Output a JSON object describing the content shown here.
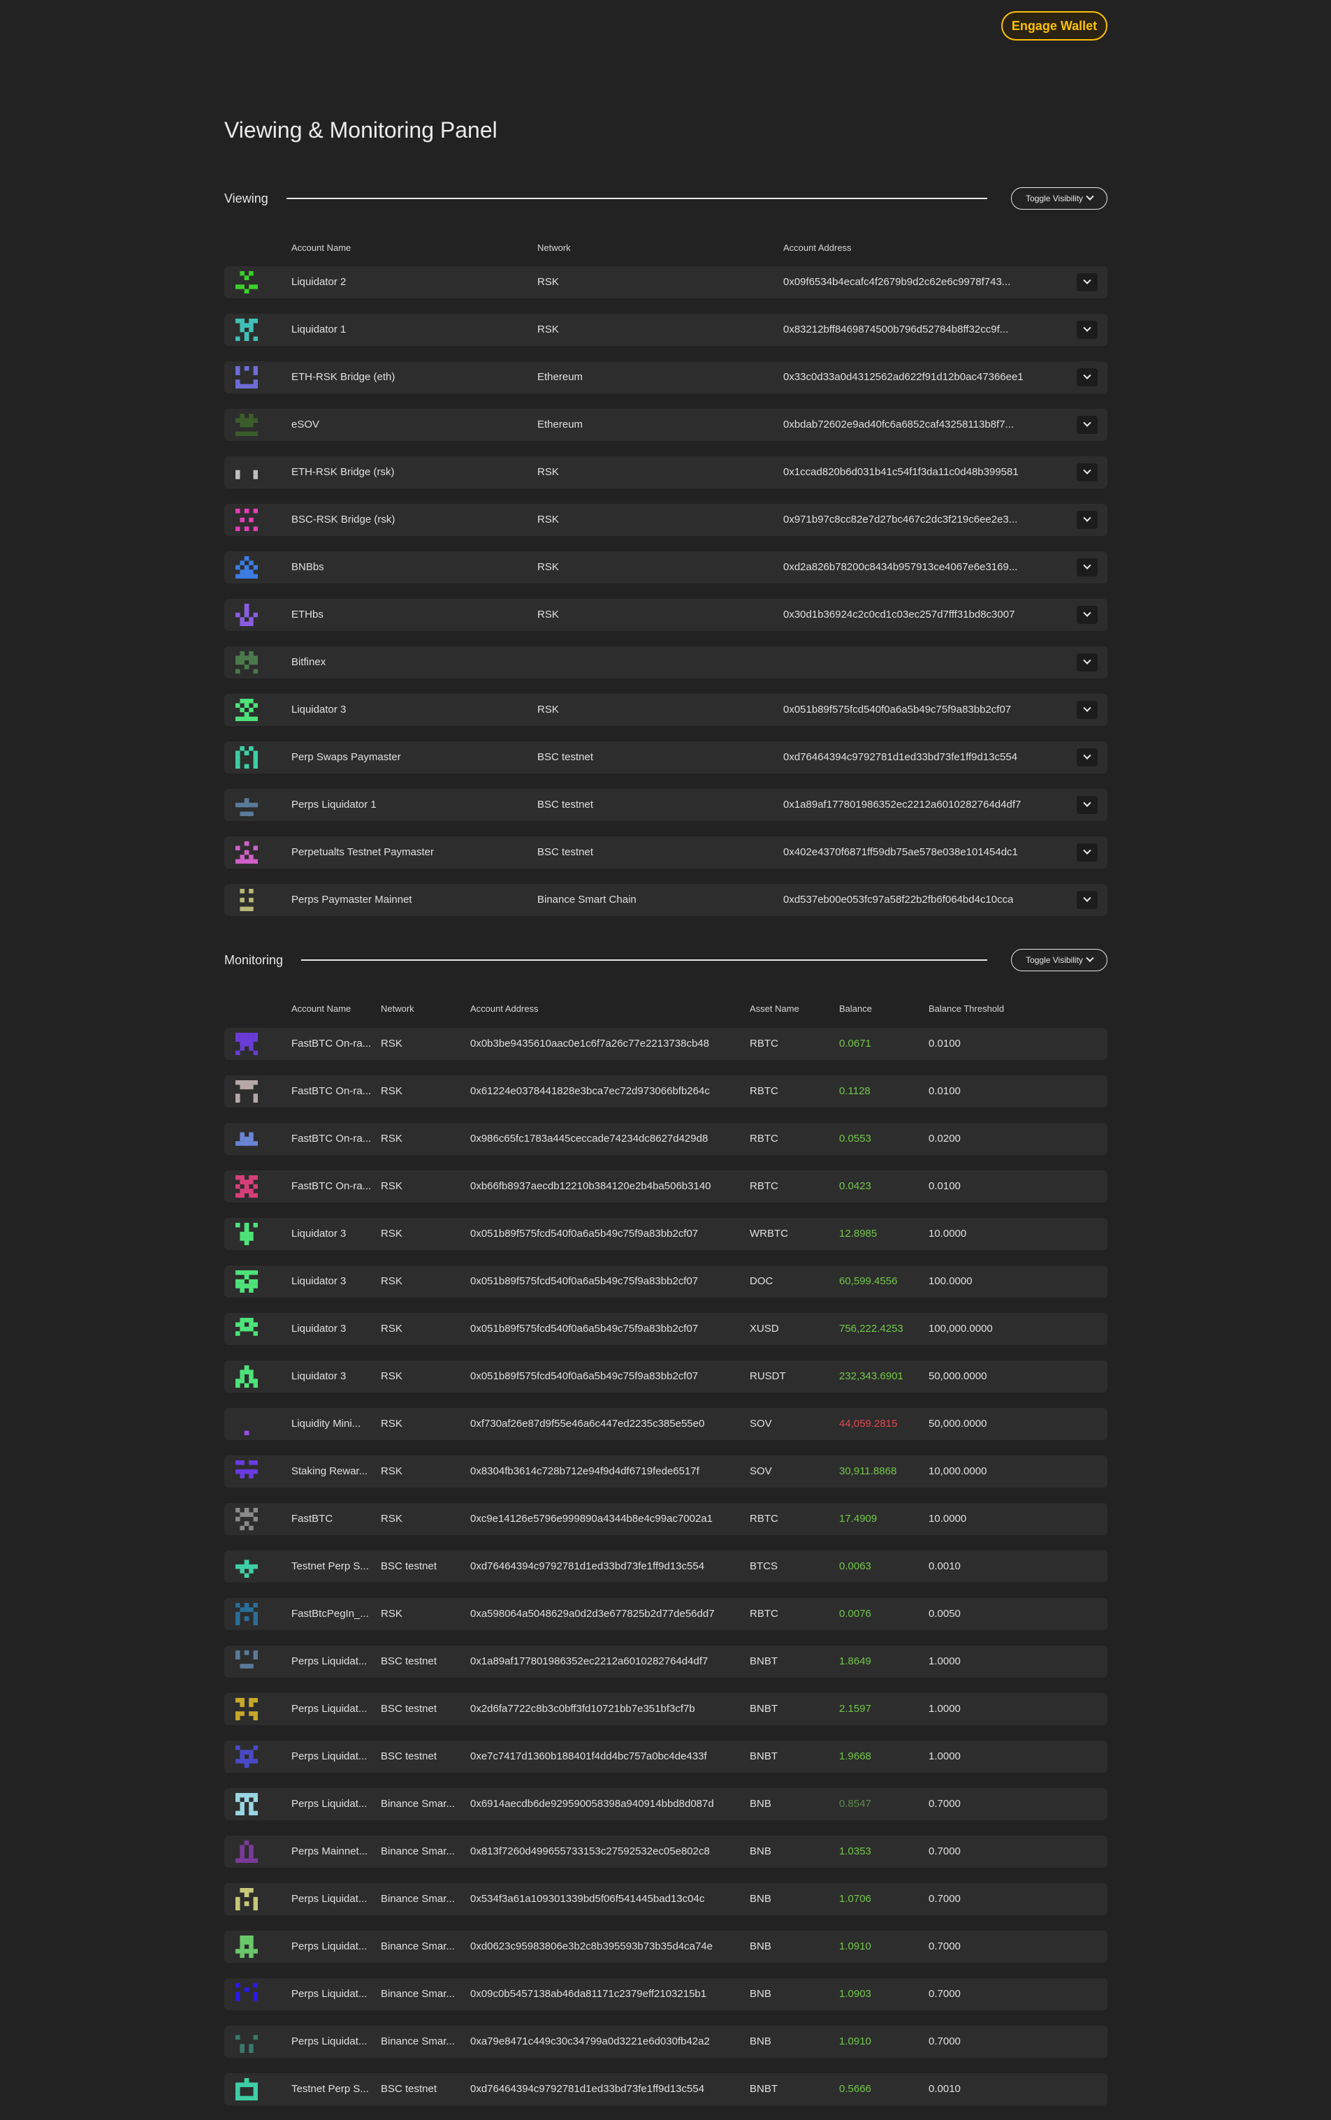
{
  "header": {
    "engage_wallet": "Engage Wallet"
  },
  "page_title": "Viewing & Monitoring Panel",
  "viewing": {
    "label": "Viewing",
    "toggle": "Toggle Visibility",
    "columns": [
      "Account Name",
      "Network",
      "Account Address"
    ],
    "rows": [
      {
        "name": "Liquidator 2",
        "network": "RSK",
        "address": "0x09f6534b4ecafc4f2679b9d2c62e6c9978f743...",
        "color": "#3bd12a"
      },
      {
        "name": "Liquidator 1",
        "network": "RSK",
        "address": "0x83212bff8469874500b796d52784b8ff32cc9f...",
        "color": "#41c0b7"
      },
      {
        "name": "ETH-RSK Bridge (eth)",
        "network": "Ethereum",
        "address": "0x33c0d33a0d4312562ad622f91d12b0ac47366ee1",
        "color": "#6f6cd6"
      },
      {
        "name": "eSOV",
        "network": "Ethereum",
        "address": "0xbdab72602e9ad40fc6a6852caf43258113b8f7...",
        "color": "#3b5d2b"
      },
      {
        "name": "ETH-RSK Bridge (rsk)",
        "network": "RSK",
        "address": "0x1ccad820b6d031b41c54f1f3da11c0d48b399581",
        "color": "#c0c0c0"
      },
      {
        "name": "BSC-RSK Bridge (rsk)",
        "network": "RSK",
        "address": "0x971b97c8cc82e7d27bc467c2dc3f219c6ee2e3...",
        "color": "#e23fb8"
      },
      {
        "name": "BNBbs",
        "network": "RSK",
        "address": "0xd2a826b78200c8434b957913ce4067e6e3169...",
        "color": "#3b7de3"
      },
      {
        "name": "ETHbs",
        "network": "RSK",
        "address": "0x30d1b36924c2c0cd1c03ec257d7fff31bd8c3007",
        "color": "#8a5de0"
      },
      {
        "name": "Bitfinex",
        "network": "",
        "address": "",
        "color": "#4a7a4a"
      },
      {
        "name": "Liquidator 3",
        "network": "RSK",
        "address": "0x051b89f575fcd540f0a6a5b49c75f9a83bb2cf07",
        "color": "#4ee37a"
      },
      {
        "name": "Perp Swaps Paymaster",
        "network": "BSC testnet",
        "address": "0xd76464394c9792781d1ed33bd73fe1ff9d13c554",
        "color": "#3fcfa6"
      },
      {
        "name": "Perps Liquidator 1",
        "network": "BSC testnet",
        "address": "0x1a89af177801986352ec2212a6010282764d4df7",
        "color": "#5a7a99"
      },
      {
        "name": "Perpetualts Testnet Paymaster",
        "network": "BSC testnet",
        "address": "0x402e4370f6871ff59db75ae578e038e101454dc1",
        "color": "#d060c8"
      },
      {
        "name": "Perps Paymaster Mainnet",
        "network": "Binance Smart Chain",
        "address": "0xd537eb00e053fc97a58f22b2fb6f064bd4c10cca",
        "color": "#b8b87a"
      }
    ]
  },
  "monitoring": {
    "label": "Monitoring",
    "toggle": "Toggle Visibility",
    "columns": [
      "Account Name",
      "Network",
      "Account Address",
      "Asset Name",
      "Balance",
      "Balance Threshold"
    ],
    "rows": [
      {
        "name": "FastBTC On-ra...",
        "network": "RSK",
        "address": "0x0b3be9435610aac0e1c6f7a26c77e2213738cb48",
        "asset": "RBTC",
        "balance": "0.0671",
        "threshold": "0.0100",
        "status": "pos",
        "color": "#6a3bd6"
      },
      {
        "name": "FastBTC On-ra...",
        "network": "RSK",
        "address": "0x61224e0378441828e3bca7ec72d973066bfb264c",
        "asset": "RBTC",
        "balance": "0.1128",
        "threshold": "0.0100",
        "status": "pos",
        "color": "#b8a8a8"
      },
      {
        "name": "FastBTC On-ra...",
        "network": "RSK",
        "address": "0x986c65fc1783a445ceccade74234dc8627d429d8",
        "asset": "RBTC",
        "balance": "0.0553",
        "threshold": "0.0200",
        "status": "pos",
        "color": "#6a84d6"
      },
      {
        "name": "FastBTC On-ra...",
        "network": "RSK",
        "address": "0xb66fb8937aecdb12210b384120e2b4ba506b3140",
        "asset": "RBTC",
        "balance": "0.0423",
        "threshold": "0.0100",
        "status": "pos",
        "color": "#d63f7a"
      },
      {
        "name": "Liquidator 3",
        "network": "RSK",
        "address": "0x051b89f575fcd540f0a6a5b49c75f9a83bb2cf07",
        "asset": "WRBTC",
        "balance": "12.8985",
        "threshold": "10.0000",
        "status": "pos",
        "color": "#4ee37a"
      },
      {
        "name": "Liquidator 3",
        "network": "RSK",
        "address": "0x051b89f575fcd540f0a6a5b49c75f9a83bb2cf07",
        "asset": "DOC",
        "balance": "60,599.4556",
        "threshold": "100.0000",
        "status": "pos",
        "color": "#4ee37a"
      },
      {
        "name": "Liquidator 3",
        "network": "RSK",
        "address": "0x051b89f575fcd540f0a6a5b49c75f9a83bb2cf07",
        "asset": "XUSD",
        "balance": "756,222.4253",
        "threshold": "100,000.0000",
        "status": "pos",
        "color": "#4ee37a"
      },
      {
        "name": "Liquidator 3",
        "network": "RSK",
        "address": "0x051b89f575fcd540f0a6a5b49c75f9a83bb2cf07",
        "asset": "RUSDT",
        "balance": "232,343.6901",
        "threshold": "50,000.0000",
        "status": "pos",
        "color": "#4ee37a"
      },
      {
        "name": "Liquidity Mini...",
        "network": "RSK",
        "address": "0xf730af26e87d9f55e46a6c447ed2235c385e55e0",
        "asset": "SOV",
        "balance": "44,059.2815",
        "threshold": "50,000.0000",
        "status": "neg",
        "color": "#9a4ee3"
      },
      {
        "name": "Staking Rewar...",
        "network": "RSK",
        "address": "0x8304fb3614c728b712e94f9d4df6719fede6517f",
        "asset": "SOV",
        "balance": "30,911.8868",
        "threshold": "10,000.0000",
        "status": "pos",
        "color": "#6a3be3"
      },
      {
        "name": "FastBTC",
        "network": "RSK",
        "address": "0xc9e14126e5796e999890a4344b8e4c99ac7002a1",
        "asset": "RBTC",
        "balance": "17.4909",
        "threshold": "10.0000",
        "status": "pos",
        "color": "#8a8a8a"
      },
      {
        "name": "Testnet Perp S...",
        "network": "BSC testnet",
        "address": "0xd76464394c9792781d1ed33bd73fe1ff9d13c554",
        "asset": "BTCS",
        "balance": "0.0063",
        "threshold": "0.0010",
        "status": "pos",
        "color": "#3fcfa6"
      },
      {
        "name": "FastBtcPegIn_...",
        "network": "RSK",
        "address": "0xa598064a5048629a0d2d3e677825b2d77de56dd7",
        "asset": "RBTC",
        "balance": "0.0076",
        "threshold": "0.0050",
        "status": "pos",
        "color": "#2a6e9a"
      },
      {
        "name": "Perps Liquidat...",
        "network": "BSC testnet",
        "address": "0x1a89af177801986352ec2212a6010282764d4df7",
        "asset": "BNBT",
        "balance": "1.8649",
        "threshold": "1.0000",
        "status": "pos",
        "color": "#5a7a99"
      },
      {
        "name": "Perps Liquidat...",
        "network": "BSC testnet",
        "address": "0x2d6fa7722c8b3c0bff3fd10721bb7e351bf3cf7b",
        "asset": "BNBT",
        "balance": "2.1597",
        "threshold": "1.0000",
        "status": "pos",
        "color": "#c8a82a"
      },
      {
        "name": "Perps Liquidat...",
        "network": "BSC testnet",
        "address": "0xe7c7417d1360b188401f4dd4bc757a0bc4de433f",
        "asset": "BNBT",
        "balance": "1.9668",
        "threshold": "1.0000",
        "status": "pos",
        "color": "#4a4ac8"
      },
      {
        "name": "Perps Liquidat...",
        "network": "Binance Smar...",
        "address": "0x6914aecdb6de929590058398a940914bbd8d087d",
        "asset": "BNB",
        "balance": "0.8547",
        "threshold": "0.7000",
        "status": "dim",
        "color": "#9ad6e3"
      },
      {
        "name": "Perps Mainnet...",
        "network": "Binance Smar...",
        "address": "0x813f7260d499655733153c27592532ec05e802c8",
        "asset": "BNB",
        "balance": "1.0353",
        "threshold": "0.7000",
        "status": "pos",
        "color": "#7a3b9a"
      },
      {
        "name": "Perps Liquidat...",
        "network": "Binance Smar...",
        "address": "0x534f3a61a109301339bd5f06f541445bad13c04c",
        "asset": "BNB",
        "balance": "1.0706",
        "threshold": "0.7000",
        "status": "pos",
        "color": "#c8c87a"
      },
      {
        "name": "Perps Liquidat...",
        "network": "Binance Smar...",
        "address": "0xd0623c95983806e3b2c8b395593b73b35d4ca74e",
        "asset": "BNB",
        "balance": "1.0910",
        "threshold": "0.7000",
        "status": "pos",
        "color": "#6ac86a"
      },
      {
        "name": "Perps Liquidat...",
        "network": "Binance Smar...",
        "address": "0x09c0b5457138ab46da81171c2379eff2103215b1",
        "asset": "BNB",
        "balance": "1.0903",
        "threshold": "0.7000",
        "status": "pos",
        "color": "#2a1ae3"
      },
      {
        "name": "Perps Liquidat...",
        "network": "Binance Smar...",
        "address": "0xa79e8471c449c30c34799a0d3221e6d030fb42a2",
        "asset": "BNB",
        "balance": "1.0910",
        "threshold": "0.7000",
        "status": "pos",
        "color": "#3a7a6a"
      },
      {
        "name": "Testnet Perp S...",
        "network": "BSC testnet",
        "address": "0xd76464394c9792781d1ed33bd73fe1ff9d13c554",
        "asset": "BNBT",
        "balance": "0.5666",
        "threshold": "0.0010",
        "status": "pos",
        "color": "#3fcfa6"
      }
    ]
  }
}
